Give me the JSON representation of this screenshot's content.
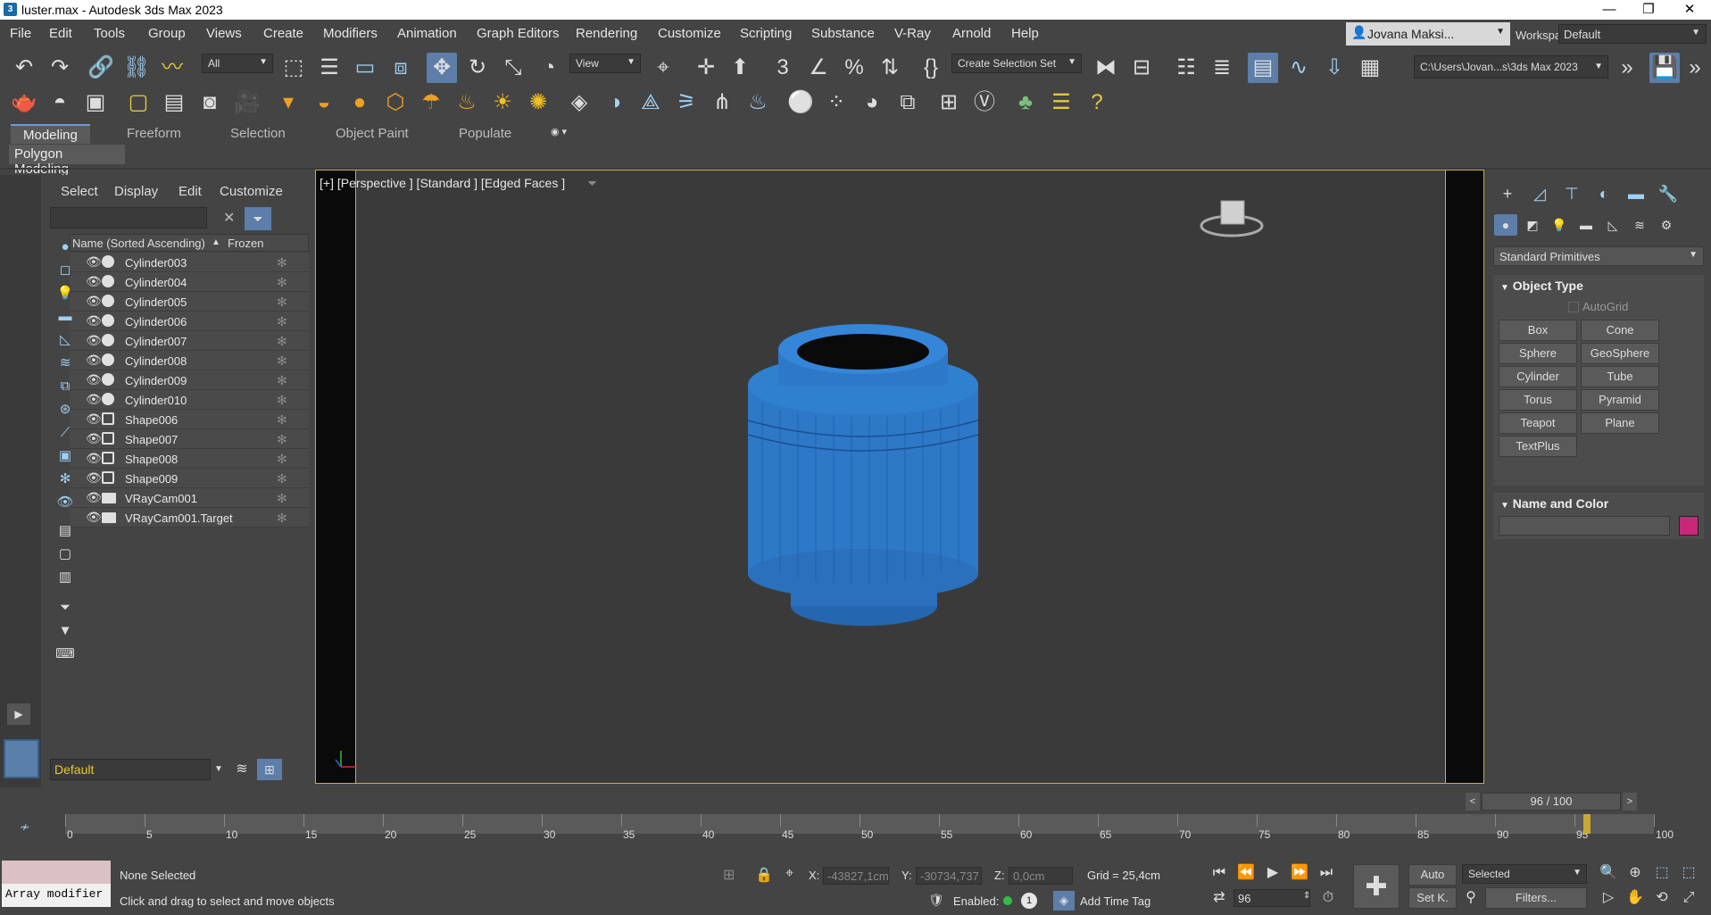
{
  "window": {
    "title": "luster.max - Autodesk 3ds Max 2023",
    "minimize": "—",
    "restore": "❐",
    "close": "✕"
  },
  "menu": [
    "File",
    "Edit",
    "Tools",
    "Group",
    "Views",
    "Create",
    "Modifiers",
    "Animation",
    "Graph Editors",
    "Rendering",
    "Customize",
    "Scripting",
    "Substance",
    "V-Ray",
    "Arnold",
    "Help"
  ],
  "user": {
    "name": "Jovana Maksi..."
  },
  "workspaces": {
    "label": "Workspaces:",
    "value": "Default"
  },
  "toolbar1": {
    "selection_filter": "All",
    "reference_coord": "View",
    "selection_set": "Create Selection Set",
    "project_path": "C:\\Users\\Jovan...s\\3ds Max 2023"
  },
  "ribbon": {
    "tabs": [
      "Modeling",
      "Freeform",
      "Selection",
      "Object Paint",
      "Populate"
    ],
    "active_tab": "Modeling",
    "subpanel": "Polygon Modeling"
  },
  "explorer": {
    "menu": [
      "Select",
      "Display",
      "Edit",
      "Customize"
    ],
    "column_name": "Name (Sorted Ascending)",
    "column_frozen": "Frozen",
    "rows": [
      {
        "name": "Cylinder003",
        "type": "geometry"
      },
      {
        "name": "Cylinder004",
        "type": "geometry"
      },
      {
        "name": "Cylinder005",
        "type": "geometry"
      },
      {
        "name": "Cylinder006",
        "type": "geometry"
      },
      {
        "name": "Cylinder007",
        "type": "geometry"
      },
      {
        "name": "Cylinder008",
        "type": "geometry"
      },
      {
        "name": "Cylinder009",
        "type": "geometry"
      },
      {
        "name": "Cylinder010",
        "type": "geometry"
      },
      {
        "name": "Shape006",
        "type": "shape"
      },
      {
        "name": "Shape007",
        "type": "shape"
      },
      {
        "name": "Shape008",
        "type": "shape"
      },
      {
        "name": "Shape009",
        "type": "shape"
      },
      {
        "name": "VRayCam001",
        "type": "camera"
      },
      {
        "name": "VRayCam001.Target",
        "type": "camera"
      }
    ],
    "layer": "Default"
  },
  "viewport": {
    "label": "[+] [Perspective ] [Standard ] [Edged Faces ]",
    "object_color": "#2e78c8"
  },
  "command_panel": {
    "category": "Standard Primitives",
    "object_type_title": "Object Type",
    "autogrid": "AutoGrid",
    "primitives": [
      "Box",
      "Cone",
      "Sphere",
      "GeoSphere",
      "Cylinder",
      "Tube",
      "Torus",
      "Pyramid",
      "Teapot",
      "Plane",
      "TextPlus"
    ],
    "name_color_title": "Name and Color",
    "color_swatch": "#c8287a"
  },
  "timeline": {
    "frame_counter": "96 / 100",
    "current_frame": 96,
    "total_frames": 100,
    "ticks": [
      0,
      5,
      10,
      15,
      20,
      25,
      30,
      35,
      40,
      45,
      50,
      55,
      60,
      65,
      70,
      75,
      80,
      85,
      90,
      95,
      100
    ]
  },
  "status": {
    "maxscript_line": "Array modifier",
    "selection": "None Selected",
    "prompt": "Click and drag to select and move objects",
    "x_label": "X:",
    "x_value": "-43827,1cm",
    "y_label": "Y:",
    "y_value": "-30734,737",
    "z_label": "Z:",
    "z_value": "0,0cm",
    "grid": "Grid = 25,4cm",
    "enabled_label": "Enabled:",
    "time_tag": "Add Time Tag",
    "auto_key": "Auto",
    "set_key": "Set K.",
    "key_mode": "Selected",
    "filters": "Filters...",
    "frame_field": "96"
  }
}
